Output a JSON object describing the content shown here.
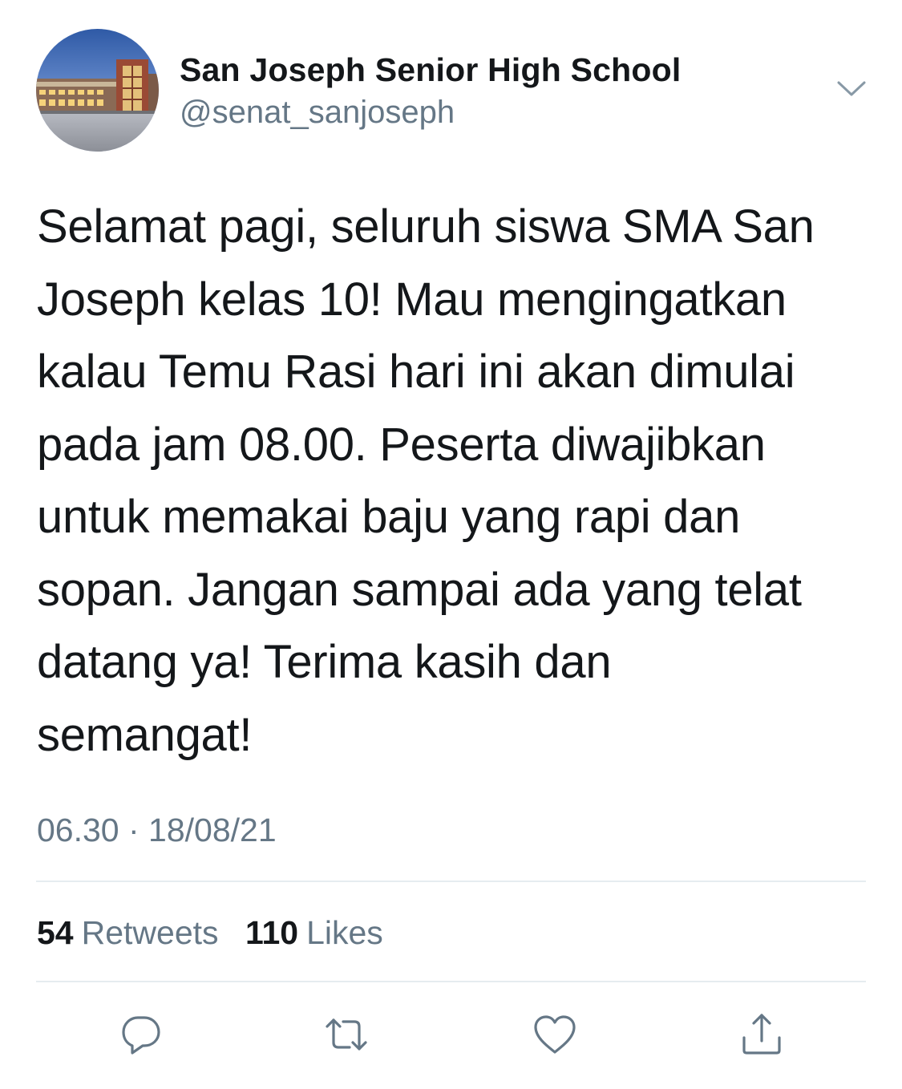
{
  "account": {
    "name": "San Joseph Senior High School",
    "handle": "@senat_sanjoseph",
    "avatar_description": "school-building-photo"
  },
  "tweet": {
    "lines": [
      "Selamat pagi, seluruh siswa SMA San",
      "Joseph kelas 10! Mau mengingatkan",
      "kalau Temu Rasi hari ini akan dimulai",
      "pada jam 08.00. Peserta diwajibkan",
      "untuk memakai baju yang rapi dan",
      "sopan. Jangan sampai ada yang telat",
      "datang ya! Terima kasih dan",
      "semangat!"
    ],
    "timestamp": "06.30 · 18/08/21"
  },
  "stats": {
    "retweets_count": "54",
    "retweets_label": "Retweets",
    "likes_count": "110",
    "likes_label": "Likes"
  },
  "actions": {
    "reply_icon": "reply-icon",
    "retweet_icon": "retweet-icon",
    "like_icon": "heart-icon",
    "share_icon": "share-icon"
  },
  "colors": {
    "text": "#14171a",
    "secondary": "#657786",
    "divider": "#e6ecf0",
    "icon": "#657786"
  }
}
